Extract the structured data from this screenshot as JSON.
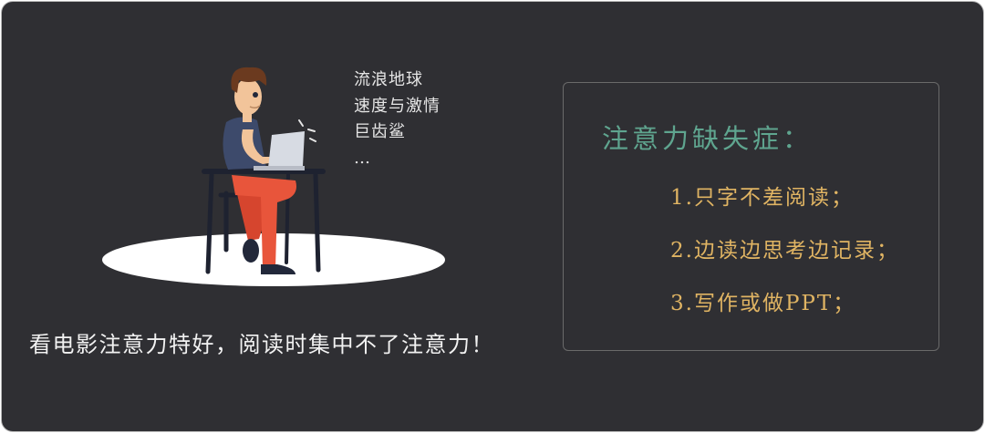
{
  "movies": [
    "流浪地球",
    "速度与激情",
    "巨齿鲨",
    "…"
  ],
  "caption": "看电影注意力特好，阅读时集中不了注意力！",
  "panel": {
    "title": "注意力缺失症：",
    "items": [
      "1.只字不差阅读；",
      "2.边读边思考边记录；",
      "3.写作或做PPT；"
    ]
  },
  "colors": {
    "background": "#2f2f33",
    "title_green": "#5fa58f",
    "item_gold": "#e0b463",
    "pants_red": "#e8553b",
    "shirt_blue": "#3d4a6b"
  }
}
